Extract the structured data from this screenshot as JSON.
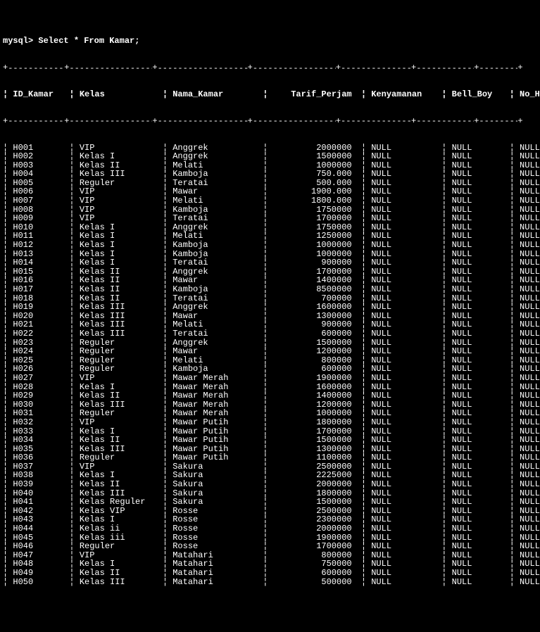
{
  "prompt": "mysql> Select * From Kamar;",
  "columns": [
    "ID_Kamar",
    "Kelas",
    "Nama_Kamar",
    "Tarif_Perjam",
    "Kenyamanan",
    "Bell_Boy",
    "No_HP"
  ],
  "chart_data": {
    "type": "table",
    "title": "Kamar",
    "columns": [
      "ID_Kamar",
      "Kelas",
      "Nama_Kamar",
      "Tarif_Perjam",
      "Kenyamanan",
      "Bell_Boy",
      "No_HP"
    ],
    "rows": [
      [
        "H001",
        "VIP",
        "Anggrek",
        "2000000",
        "NULL",
        "NULL",
        "NULL"
      ],
      [
        "H002",
        "Kelas I",
        "Anggrek",
        "1500000",
        "NULL",
        "NULL",
        "NULL"
      ],
      [
        "H003",
        "Kelas II",
        "Melati",
        "1000000",
        "NULL",
        "NULL",
        "NULL"
      ],
      [
        "H004",
        "Kelas III",
        "Kamboja",
        "750.000",
        "NULL",
        "NULL",
        "NULL"
      ],
      [
        "H005",
        "Reguler",
        "Teratai",
        "500.000",
        "NULL",
        "NULL",
        "NULL"
      ],
      [
        "H006",
        "VIP",
        "Mawar",
        "1900.000",
        "NULL",
        "NULL",
        "NULL"
      ],
      [
        "H007",
        "VIP",
        "Melati",
        "1800.000",
        "NULL",
        "NULL",
        "NULL"
      ],
      [
        "H008",
        "VIP",
        "Kamboja",
        "1750000",
        "NULL",
        "NULL",
        "NULL"
      ],
      [
        "H009",
        "VIP",
        "Teratai",
        "1700000",
        "NULL",
        "NULL",
        "NULL"
      ],
      [
        "H010",
        "Kelas I",
        "Anggrek",
        "1750000",
        "NULL",
        "NULL",
        "NULL"
      ],
      [
        "H011",
        "Kelas I",
        "Melati",
        "1250000",
        "NULL",
        "NULL",
        "NULL"
      ],
      [
        "H012",
        "Kelas I",
        "Kamboja",
        "1000000",
        "NULL",
        "NULL",
        "NULL"
      ],
      [
        "H013",
        "Kelas I",
        "Kamboja",
        "1000000",
        "NULL",
        "NULL",
        "NULL"
      ],
      [
        "H014",
        "Kelas I",
        "Teratai",
        "900000",
        "NULL",
        "NULL",
        "NULL"
      ],
      [
        "H015",
        "Kelas II",
        "Anggrek",
        "1700000",
        "NULL",
        "NULL",
        "NULL"
      ],
      [
        "H016",
        "Kelas II",
        "Mawar",
        "1400000",
        "NULL",
        "NULL",
        "NULL"
      ],
      [
        "H017",
        "Kelas II",
        "Kamboja",
        "8500000",
        "NULL",
        "NULL",
        "NULL"
      ],
      [
        "H018",
        "Kelas II",
        "Teratai",
        "700000",
        "NULL",
        "NULL",
        "NULL"
      ],
      [
        "H019",
        "Kelas III",
        "Anggrek",
        "1600000",
        "NULL",
        "NULL",
        "NULL"
      ],
      [
        "H020",
        "Kelas III",
        "Mawar",
        "1300000",
        "NULL",
        "NULL",
        "NULL"
      ],
      [
        "H021",
        "Kelas III",
        "Melati",
        "900000",
        "NULL",
        "NULL",
        "NULL"
      ],
      [
        "H022",
        "Kelas III",
        "Teratai",
        "600000",
        "NULL",
        "NULL",
        "NULL"
      ],
      [
        "H023",
        "Reguler",
        "Anggrek",
        "1500000",
        "NULL",
        "NULL",
        "NULL"
      ],
      [
        "H024",
        "Reguler",
        "Mawar",
        "1200000",
        "NULL",
        "NULL",
        "NULL"
      ],
      [
        "H025",
        "Reguler",
        "Melati",
        "800000",
        "NULL",
        "NULL",
        "NULL"
      ],
      [
        "H026",
        "Reguler",
        "Kamboja",
        "600000",
        "NULL",
        "NULL",
        "NULL"
      ],
      [
        "H027",
        "VIP",
        "Mawar Merah",
        "1900000",
        "NULL",
        "NULL",
        "NULL"
      ],
      [
        "H028",
        "Kelas I",
        "Mawar Merah",
        "1600000",
        "NULL",
        "NULL",
        "NULL"
      ],
      [
        "H029",
        "Kelas II",
        "Mawar Merah",
        "1400000",
        "NULL",
        "NULL",
        "NULL"
      ],
      [
        "H030",
        "Kelas III",
        "Mawar Merah",
        "1200000",
        "NULL",
        "NULL",
        "NULL"
      ],
      [
        "H031",
        "Reguler",
        "Mawar Merah",
        "1000000",
        "NULL",
        "NULL",
        "NULL"
      ],
      [
        "H032",
        "VIP",
        "Mawar Putih",
        "1800000",
        "NULL",
        "NULL",
        "NULL"
      ],
      [
        "H033",
        "Kelas I",
        "Mawar Putih",
        "1700000",
        "NULL",
        "NULL",
        "NULL"
      ],
      [
        "H034",
        "Kelas II",
        "Mawar Putih",
        "1500000",
        "NULL",
        "NULL",
        "NULL"
      ],
      [
        "H035",
        "Kelas III",
        "Mawar Putih",
        "1300000",
        "NULL",
        "NULL",
        "NULL"
      ],
      [
        "H036",
        "Reguler",
        "Mawar Putih",
        "1100000",
        "NULL",
        "NULL",
        "NULL"
      ],
      [
        "H037",
        "VIP",
        "Sakura",
        "2500000",
        "NULL",
        "NULL",
        "NULL"
      ],
      [
        "H038",
        "Kelas I",
        "Sakura",
        "2225000",
        "NULL",
        "NULL",
        "NULL"
      ],
      [
        "H039",
        "Kelas II",
        "Sakura",
        "2000000",
        "NULL",
        "NULL",
        "NULL"
      ],
      [
        "H040",
        "Kelas III",
        "Sakura",
        "1800000",
        "NULL",
        "NULL",
        "NULL"
      ],
      [
        "H041",
        "Kelas Reguler",
        "Sakura",
        "1500000",
        "NULL",
        "NULL",
        "NULL"
      ],
      [
        "H042",
        "Kelas VIP",
        "Rosse",
        "2500000",
        "NULL",
        "NULL",
        "NULL"
      ],
      [
        "H043",
        "Kelas I",
        "Rosse",
        "2300000",
        "NULL",
        "NULL",
        "NULL"
      ],
      [
        "H044",
        "Kelas ii",
        "Rosse",
        "2000000",
        "NULL",
        "NULL",
        "NULL"
      ],
      [
        "H045",
        "Kelas iii",
        "Rosse",
        "1900000",
        "NULL",
        "NULL",
        "NULL"
      ],
      [
        "H046",
        "Reguler",
        "Rosse",
        "1700000",
        "NULL",
        "NULL",
        "NULL"
      ],
      [
        "H047",
        "VIP",
        "Matahari",
        "800000",
        "NULL",
        "NULL",
        "NULL"
      ],
      [
        "H048",
        "Kelas I",
        "Matahari",
        "750000",
        "NULL",
        "NULL",
        "NULL"
      ],
      [
        "H049",
        "Kelas II",
        "Matahari",
        "600000",
        "NULL",
        "NULL",
        "NULL"
      ],
      [
        "H050",
        "Kelas III",
        "Matahari",
        "500000",
        "NULL",
        "NULL",
        "NULL"
      ]
    ]
  }
}
